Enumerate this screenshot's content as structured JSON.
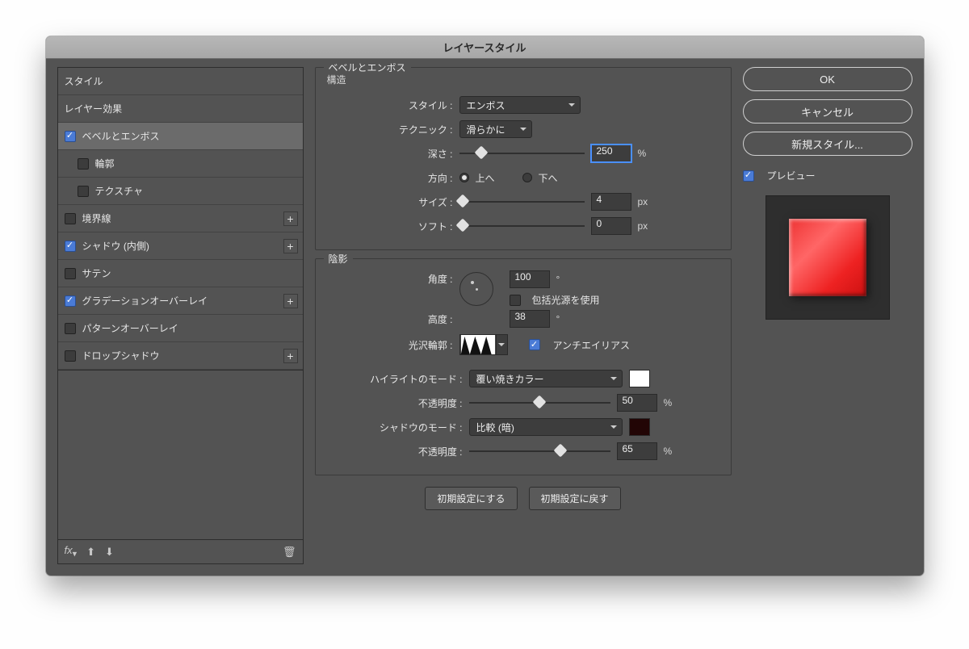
{
  "title": "レイヤースタイル",
  "left": {
    "header": "スタイル",
    "blending": "レイヤー効果",
    "bevel": "ベベルとエンボス",
    "contour": "輪郭",
    "texture": "テクスチャ",
    "stroke": "境界線",
    "inner_shadow": "シャドウ (内側)",
    "satin": "サテン",
    "grad_overlay": "グラデーションオーバーレイ",
    "pattern_overlay": "パターンオーバーレイ",
    "drop_shadow": "ドロップシャドウ",
    "fx": "fx"
  },
  "panel_title": "ベベルとエンボス",
  "structure": {
    "legend": "構造",
    "style_label": "スタイル :",
    "style_value": "エンボス",
    "technique_label": "テクニック :",
    "technique_value": "滑らかに",
    "depth_label": "深さ :",
    "depth_value": "250",
    "depth_unit": "%",
    "direction_label": "方向 :",
    "up": "上へ",
    "down": "下へ",
    "size_label": "サイズ :",
    "size_value": "4",
    "size_unit": "px",
    "soften_label": "ソフト :",
    "soften_value": "0",
    "soften_unit": "px"
  },
  "shading": {
    "legend": "陰影",
    "angle_label": "角度 :",
    "angle_value": "100",
    "angle_unit": "°",
    "global_light": "包括光源を使用",
    "altitude_label": "高度 :",
    "altitude_value": "38",
    "altitude_unit": "°",
    "gloss_label": "光沢輪郭 :",
    "antialias": "アンチエイリアス",
    "highlight_mode_label": "ハイライトのモード :",
    "highlight_mode_value": "覆い焼きカラー",
    "highlight_opacity_label": "不透明度 :",
    "highlight_opacity_value": "50",
    "highlight_opacity_unit": "%",
    "shadow_mode_label": "シャドウのモード :",
    "shadow_mode_value": "比較 (暗)",
    "shadow_opacity_label": "不透明度 :",
    "shadow_opacity_value": "65",
    "shadow_opacity_unit": "%"
  },
  "buttons": {
    "make_default": "初期設定にする",
    "reset_default": "初期設定に戻す"
  },
  "right": {
    "ok": "OK",
    "cancel": "キャンセル",
    "new_style": "新規スタイル...",
    "preview": "プレビュー"
  }
}
